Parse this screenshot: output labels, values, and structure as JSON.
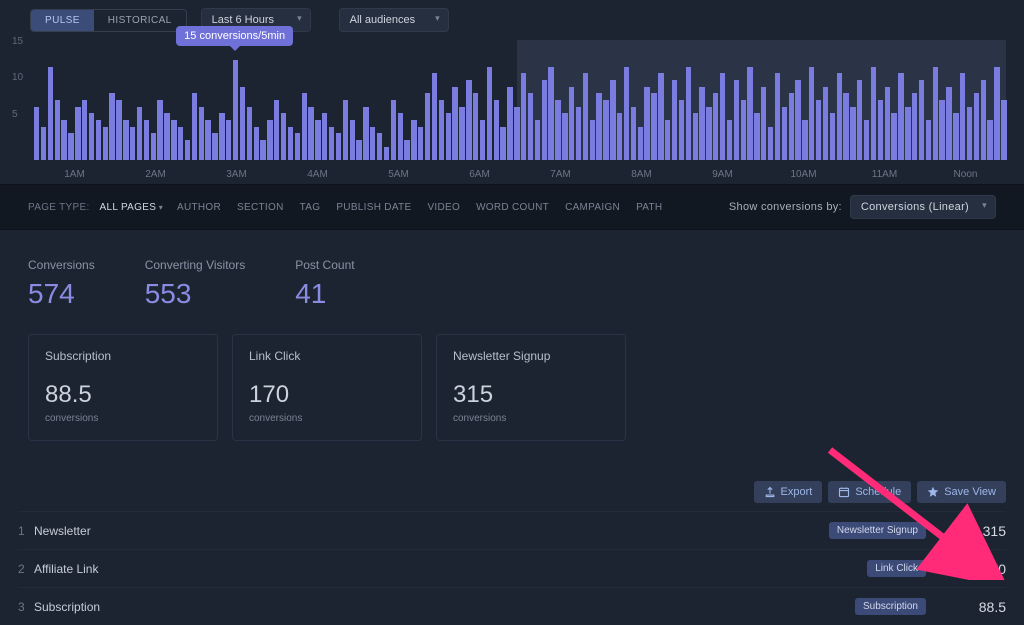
{
  "toggle": {
    "pulse": "PULSE",
    "historical": "HISTORICAL"
  },
  "time_range": "Last 6 Hours",
  "audience": "All audiences",
  "tooltip": "15 conversions/5min",
  "chart_data": {
    "type": "bar",
    "ylabel": "Conversions",
    "ylim": [
      0,
      18
    ],
    "y_ticks": [
      15,
      10,
      5
    ],
    "x_labels": [
      "1AM",
      "2AM",
      "3AM",
      "4AM",
      "5AM",
      "6AM",
      "7AM",
      "8AM",
      "9AM",
      "10AM",
      "11AM",
      "Noon"
    ],
    "highlight": {
      "from": 0.5,
      "to": 1.0
    },
    "values": [
      8,
      5,
      14,
      9,
      6,
      4,
      8,
      9,
      7,
      6,
      5,
      10,
      9,
      6,
      5,
      8,
      6,
      4,
      9,
      7,
      6,
      5,
      3,
      10,
      8,
      6,
      4,
      7,
      6,
      15,
      11,
      8,
      5,
      3,
      6,
      9,
      7,
      5,
      4,
      10,
      8,
      6,
      7,
      5,
      4,
      9,
      6,
      3,
      8,
      5,
      4,
      2,
      9,
      7,
      3,
      6,
      5,
      10,
      13,
      9,
      7,
      11,
      8,
      12,
      10,
      6,
      14,
      9,
      5,
      11,
      8,
      13,
      10,
      6,
      12,
      14,
      9,
      7,
      11,
      8,
      13,
      6,
      10,
      9,
      12,
      7,
      14,
      8,
      5,
      11,
      10,
      13,
      6,
      12,
      9,
      14,
      7,
      11,
      8,
      10,
      13,
      6,
      12,
      9,
      14,
      7,
      11,
      5,
      13,
      8,
      10,
      12,
      6,
      14,
      9,
      11,
      7,
      13,
      10,
      8,
      12,
      6,
      14,
      9,
      11,
      7,
      13,
      8,
      10,
      12,
      6,
      14,
      9,
      11,
      7,
      13,
      8,
      10,
      12,
      6,
      14,
      9
    ]
  },
  "filter": {
    "page_type_label": "PAGE TYPE:",
    "page_type_value": "ALL PAGES",
    "items": [
      "AUTHOR",
      "SECTION",
      "TAG",
      "PUBLISH DATE",
      "VIDEO",
      "WORD COUNT",
      "CAMPAIGN",
      "PATH"
    ],
    "show_label": "Show conversions by:",
    "show_value": "Conversions (Linear)"
  },
  "metrics": [
    {
      "title": "Conversions",
      "value": "574"
    },
    {
      "title": "Converting Visitors",
      "value": "553"
    },
    {
      "title": "Post Count",
      "value": "41"
    }
  ],
  "cards": [
    {
      "title": "Subscription",
      "value": "88.5",
      "unit": "conversions"
    },
    {
      "title": "Link Click",
      "value": "170",
      "unit": "conversions"
    },
    {
      "title": "Newsletter Signup",
      "value": "315",
      "unit": "conversions"
    }
  ],
  "actions": {
    "export": "Export",
    "schedule": "Schedule",
    "save_view": "Save View"
  },
  "rows": [
    {
      "idx": "1",
      "name": "Newsletter",
      "tag": "Newsletter Signup",
      "value": "315"
    },
    {
      "idx": "2",
      "name": "Affiliate Link",
      "tag": "Link Click",
      "value": "170"
    },
    {
      "idx": "3",
      "name": "Subscription",
      "tag": "Subscription",
      "value": "88.5"
    }
  ]
}
